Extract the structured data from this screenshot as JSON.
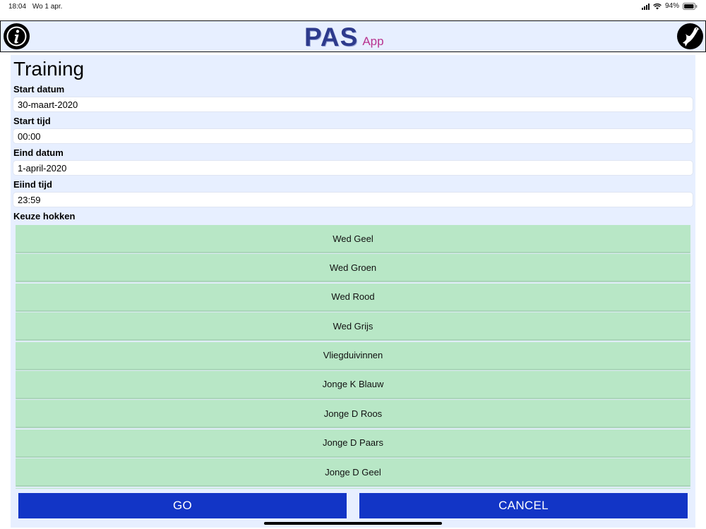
{
  "status_bar": {
    "time": "18:04",
    "date": "Wo 1 apr.",
    "battery": "94%"
  },
  "header": {
    "logo_main": "PAS",
    "logo_sub": "App"
  },
  "colors": {
    "header_bg": "#e7efff",
    "choice_bg": "#b8e7c6",
    "button_bg": "#1235c6",
    "logo_main": "#2d3a8c",
    "logo_sub": "#b8338f"
  },
  "form": {
    "title": "Training",
    "start_date_label": "Start datum",
    "start_date_value": "30-maart-2020",
    "start_time_label": "Start tijd",
    "start_time_value": "00:00",
    "end_date_label": "Eind datum",
    "end_date_value": "1-april-2020",
    "end_time_label": "Eiind tijd",
    "end_time_value": "23:59",
    "choices_label": "Keuze hokken"
  },
  "choices": [
    "Wed Geel",
    "Wed Groen",
    "Wed Rood",
    "Wed Grijs",
    "Vliegduivinnen",
    "Jonge K Blauw",
    "Jonge D Roos",
    "Jonge D Paars",
    "Jonge D Geel"
  ],
  "buttons": {
    "go": "GO",
    "cancel": "CANCEL"
  },
  "icons": {
    "left": "info-icon",
    "right": "pigeon-icon"
  }
}
